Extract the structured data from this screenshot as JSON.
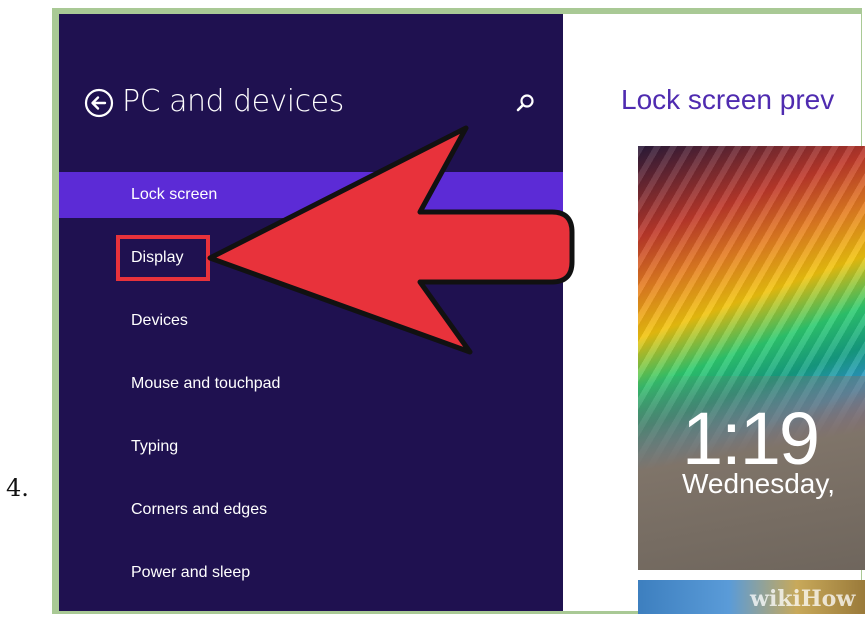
{
  "step_number": "4.",
  "panel": {
    "title": "PC and devices",
    "back_icon": "back-arrow-circle-icon",
    "search_icon": "search-icon",
    "nav_items": [
      {
        "label": "Lock screen",
        "selected": true
      },
      {
        "label": "Display",
        "selected": false
      },
      {
        "label": "Devices",
        "selected": false
      },
      {
        "label": "Mouse and touchpad",
        "selected": false
      },
      {
        "label": "Typing",
        "selected": false
      },
      {
        "label": "Corners and edges",
        "selected": false
      },
      {
        "label": "Power and sleep",
        "selected": false
      }
    ]
  },
  "content": {
    "preview_title": "Lock screen prev",
    "preview_time": "1:19",
    "preview_date": "Wednesday,"
  },
  "watermark": "wikiHow",
  "colors": {
    "panel_bg": "#1f1150",
    "selected_bg": "#5c2bd6",
    "accent_text": "#4f2bb0",
    "arrow_red": "#e8323b",
    "frame_green": "#a9c995"
  }
}
